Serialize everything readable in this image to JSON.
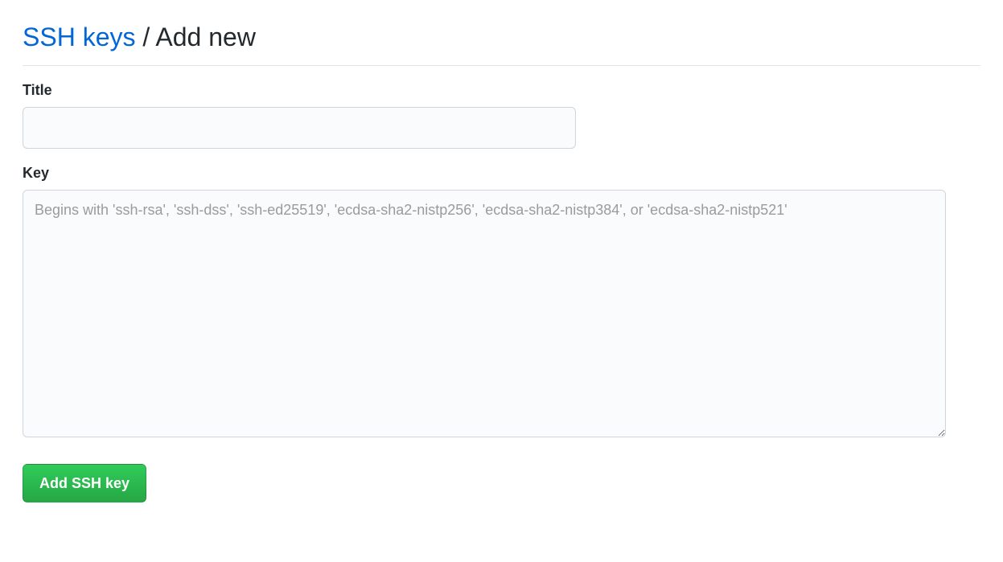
{
  "header": {
    "link_text": "SSH keys",
    "separator": " / ",
    "current": "Add new"
  },
  "form": {
    "title": {
      "label": "Title",
      "value": ""
    },
    "key": {
      "label": "Key",
      "placeholder": "Begins with 'ssh-rsa', 'ssh-dss', 'ssh-ed25519', 'ecdsa-sha2-nistp256', 'ecdsa-sha2-nistp384', or 'ecdsa-sha2-nistp521'",
      "value": ""
    },
    "submit_label": "Add SSH key"
  },
  "colors": {
    "link": "#0366d6",
    "button_bg_start": "#2fcc5a",
    "button_bg_end": "#27a744",
    "border": "#d1d5da",
    "input_bg": "#fafbfc"
  }
}
